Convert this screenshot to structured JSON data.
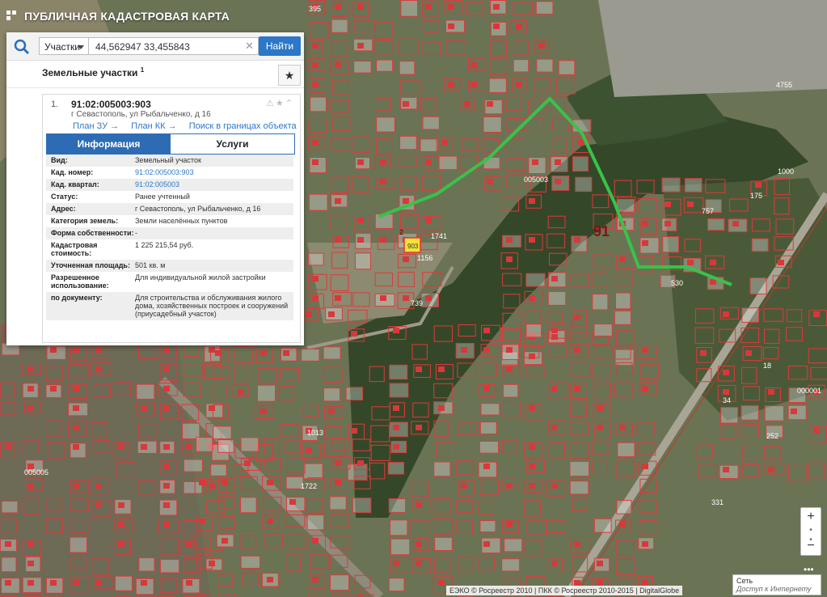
{
  "header": {
    "title": "ПУБЛИЧНАЯ КАДАСТРОВАЯ КАРТА"
  },
  "search": {
    "type_label": "Участки",
    "query": "44,562947 33,455843",
    "find_label": "Найти"
  },
  "results": {
    "layer_title": "Земельные участки",
    "count": "1",
    "item": {
      "index": "1.",
      "cad_number": "91:02:005003:903",
      "address": "г Севастополь, ул Рыбальченко, д 16",
      "links": [
        "План ЗУ →",
        "План КК →",
        "Поиск в границах объекта →"
      ],
      "tabs": [
        "Информация",
        "Услуги"
      ],
      "attributes": [
        {
          "key": "Вид:",
          "value": "Земельный участок"
        },
        {
          "key": "Кад. номер:",
          "value": "91:02:005003:903"
        },
        {
          "key": "Кад. квартал:",
          "value": "91:02:005003"
        },
        {
          "key": "Статус:",
          "value": "Ранее учтенный"
        },
        {
          "key": "Адрес:",
          "value": "г Севастополь, ул Рыбальченко, д 16"
        },
        {
          "key": "Категория земель:",
          "value": "Земли населённых пунктов"
        },
        {
          "key": "Форма собственности:",
          "value": "-"
        },
        {
          "key": "Кадастровая стоимость:",
          "value": "1 225 215,54 руб."
        },
        {
          "key": "Уточненная площадь:",
          "value": "501 кв. м"
        },
        {
          "key": "Разрешенное использование:",
          "value": "Для индивидуальной жилой застройки"
        },
        {
          "key": "по документу:",
          "value": "Для строительства и обслуживания жилого дома, хозяйственных построек и сооружений (приусадебный участок)"
        }
      ]
    }
  },
  "map": {
    "labels": [
      "395",
      "005003",
      "91",
      "2",
      "903",
      "1741",
      "1156",
      "739",
      "005005",
      "4755",
      "1000",
      "175",
      "757",
      "530",
      "252",
      "331",
      "1013",
      "1722",
      "18",
      "34",
      "000001"
    ],
    "colors": {
      "parcel": "#e0393b",
      "route": "#39c24a",
      "selected": "#f2e23a"
    }
  },
  "zoom": {
    "plus": "+",
    "minus": "−"
  },
  "network": {
    "title": "Сеть",
    "status": "Доступ к Интернету"
  },
  "attribution": "ЕЭКО © Росреестр 2010 | ПКК © Росреестр 2010-2015 | DigitalGlobe"
}
